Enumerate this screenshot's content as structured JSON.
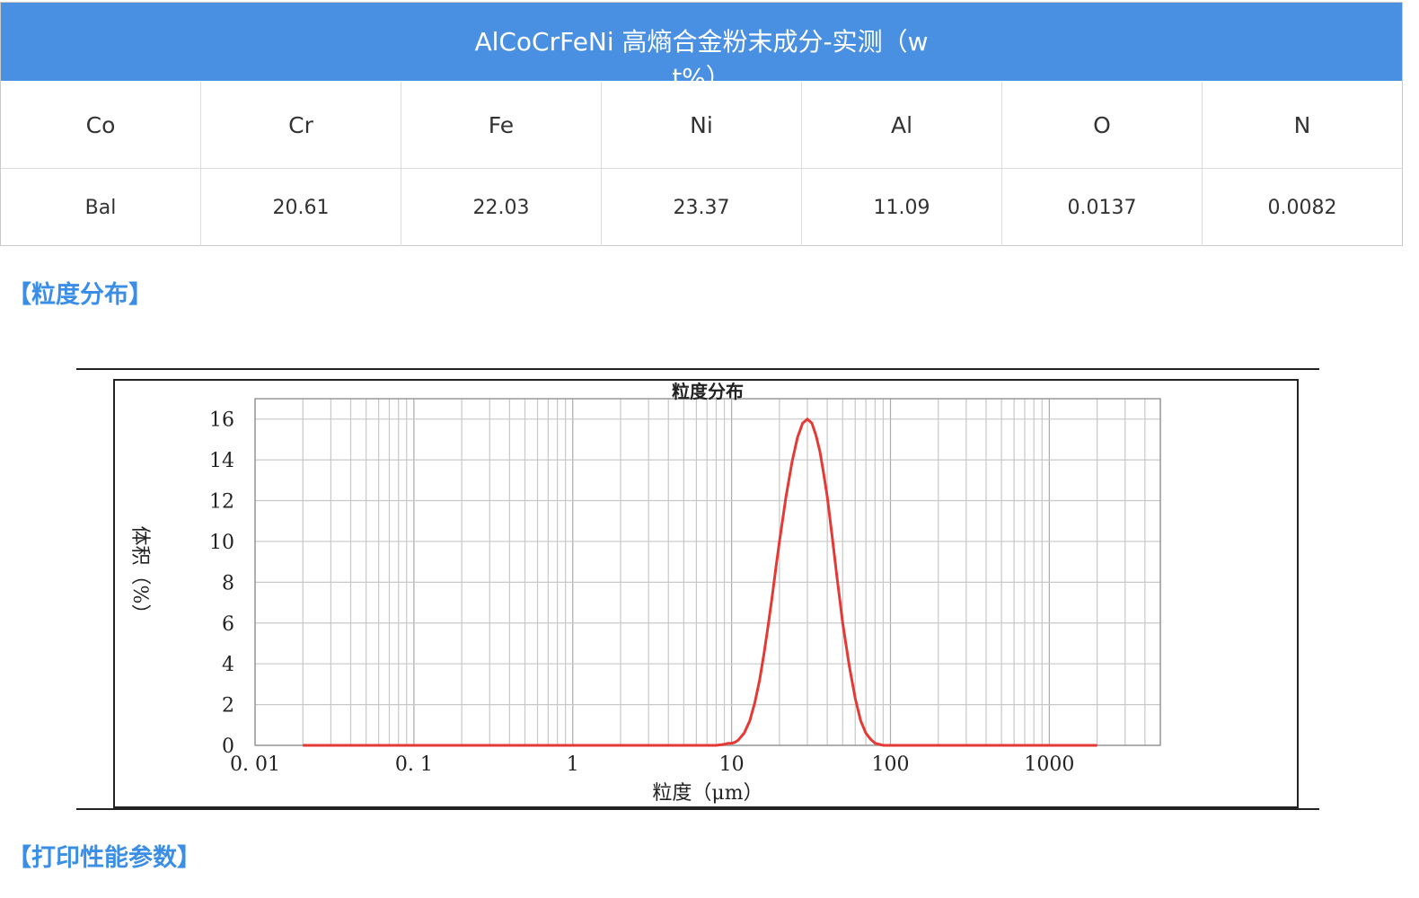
{
  "composition_table": {
    "title": "AlCoCrFeNi  高熵合金粉末成分-实测（wt%）",
    "columns": [
      "Co",
      "Cr",
      "Fe",
      "Ni",
      "Al",
      "O",
      "N"
    ],
    "values": [
      "Bal",
      "20.61",
      "22.03",
      "23.37",
      "11.09",
      "0.0137",
      "0.0082"
    ],
    "header_color": "#4a90e2"
  },
  "sections": {
    "particle_size": "【粒度分布】",
    "print_params": "【打印性能参数】"
  },
  "chart_data": {
    "type": "line",
    "title": "粒度分布",
    "xlabel": "粒度（μm）",
    "ylabel": "体积（%）",
    "x_scale": "log",
    "xlim": [
      0.01,
      5000
    ],
    "ylim": [
      0,
      17
    ],
    "x_tick_labels": [
      "0. 01",
      "0. 1",
      "1",
      "10",
      "100",
      "1000"
    ],
    "y_tick_labels": [
      "0",
      "2",
      "4",
      "6",
      "8",
      "10",
      "12",
      "14",
      "16"
    ],
    "grid": true,
    "line_color": "#e53935",
    "series": [
      {
        "x": [
          0.02,
          0.1,
          1,
          8,
          9,
          9.5,
          10,
          10.5,
          11,
          12,
          13,
          14,
          15,
          16,
          17,
          18,
          19,
          20,
          22,
          24,
          26,
          28,
          30,
          32,
          34,
          36,
          38,
          40,
          43,
          46,
          50,
          55,
          60,
          65,
          70,
          75,
          80,
          90,
          100,
          200,
          1000,
          2000
        ],
        "y": [
          0,
          0,
          0,
          0,
          0.05,
          0.1,
          0.1,
          0.15,
          0.25,
          0.6,
          1.2,
          2.1,
          3.2,
          4.5,
          5.9,
          7.3,
          8.7,
          10.0,
          12.2,
          13.9,
          15.1,
          15.8,
          16.0,
          15.8,
          15.2,
          14.4,
          13.3,
          12.2,
          10.2,
          8.3,
          6.0,
          3.9,
          2.3,
          1.2,
          0.6,
          0.3,
          0.1,
          0,
          0,
          0,
          0,
          0
        ]
      }
    ]
  }
}
